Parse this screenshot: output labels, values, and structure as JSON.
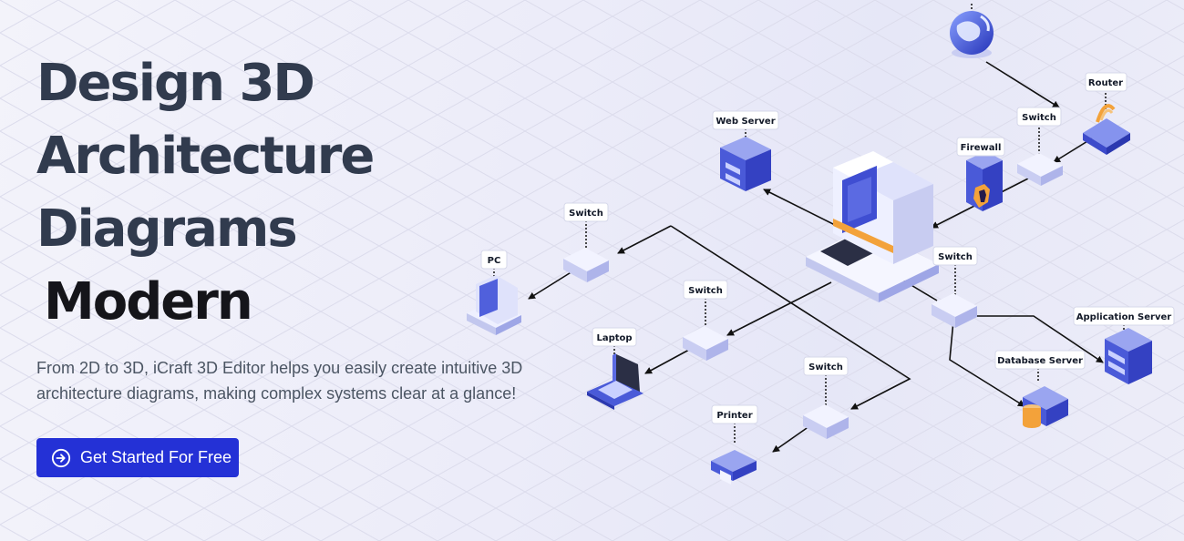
{
  "hero": {
    "headline_lines": [
      "Design 3D",
      "Architecture",
      "Diagrams"
    ],
    "accent_word": "Modern",
    "description": "From 2D to 3D, iCraft 3D Editor helps you easily create intuitive 3D architecture diagrams, making complex systems clear at a glance!",
    "cta_label": "Get Started For Free",
    "cta_icon": "arrow-circle-right-icon"
  },
  "colors": {
    "accent": "#2431d6",
    "headline": "#313b4e",
    "device_blue": "#4a5ad8",
    "device_orange": "#f3a23a"
  },
  "diagram": {
    "labels": {
      "web_server": "Web Server",
      "router": "Router",
      "switch_top": "Switch",
      "firewall": "Firewall",
      "switch_left": "Switch",
      "pc": "PC",
      "switch_mid": "Switch",
      "laptop": "Laptop",
      "switch_right": "Switch",
      "application_server": "Application Server",
      "database_server": "Database Server",
      "switch_bottom": "Switch",
      "printer": "Printer"
    }
  }
}
